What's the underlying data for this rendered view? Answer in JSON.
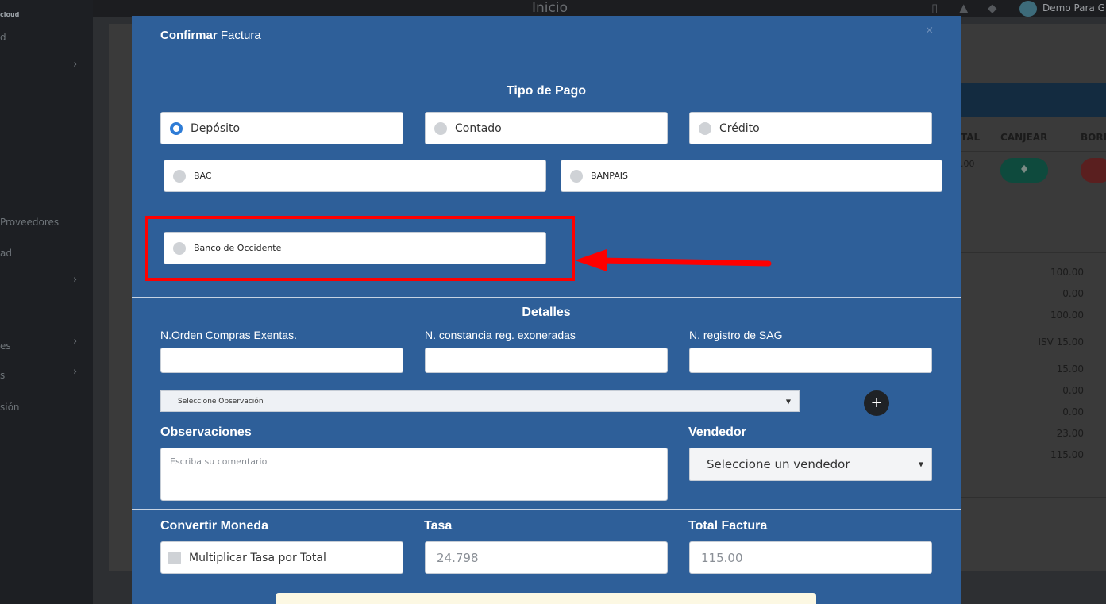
{
  "background": {
    "sidebar": {
      "brand": "cloud",
      "items": [
        "d",
        "Proveedores",
        "ad",
        "es",
        "s",
        "sión"
      ]
    },
    "topbar": {
      "title": "Inicio",
      "user": "Demo Para G"
    },
    "table": {
      "headers": [
        "TAL",
        "CANJEAR",
        "BORR"
      ],
      "row_value": ".00",
      "totals": [
        "100.00",
        "0.00",
        "100.00",
        "ISV 15.00",
        "15.00",
        "0.00",
        "0.00",
        "23.00",
        "115.00"
      ]
    }
  },
  "modal": {
    "title_bold": "Confirmar",
    "title_rest": " Factura",
    "close": "×",
    "tipo_pago": {
      "title": "Tipo de Pago",
      "options": [
        {
          "label": "Depósito",
          "selected": true
        },
        {
          "label": "Contado",
          "selected": false
        },
        {
          "label": "Crédito",
          "selected": false
        }
      ],
      "banks": [
        {
          "label": "BAC",
          "selected": false
        },
        {
          "label": "BANPAIS",
          "selected": false
        },
        {
          "label": "Banco de Occidente",
          "selected": false
        }
      ]
    },
    "detalles": {
      "title": "Detalles",
      "orden_label": "N.Orden Compras Exentas.",
      "constancia_label": "N. constancia reg. exoneradas",
      "sag_label": "N. registro de SAG",
      "observacion_select": "Seleccione Observación",
      "add_button": "+",
      "observaciones_label": "Observaciones",
      "observaciones_placeholder": "Escriba su comentario",
      "vendedor_label": "Vendedor",
      "vendedor_select": "Seleccione un vendedor"
    },
    "moneda": {
      "convertir_label": "Convertir Moneda",
      "multiplicar_label": "Multiplicar Tasa por Total",
      "tasa_label": "Tasa",
      "tasa_value": "24.798",
      "total_label": "Total Factura",
      "total_value": "115.00"
    }
  },
  "colors": {
    "modal_bg": "#2e5f99",
    "highlight": "#ff0000",
    "radio_selected": "#2e7cd6"
  }
}
